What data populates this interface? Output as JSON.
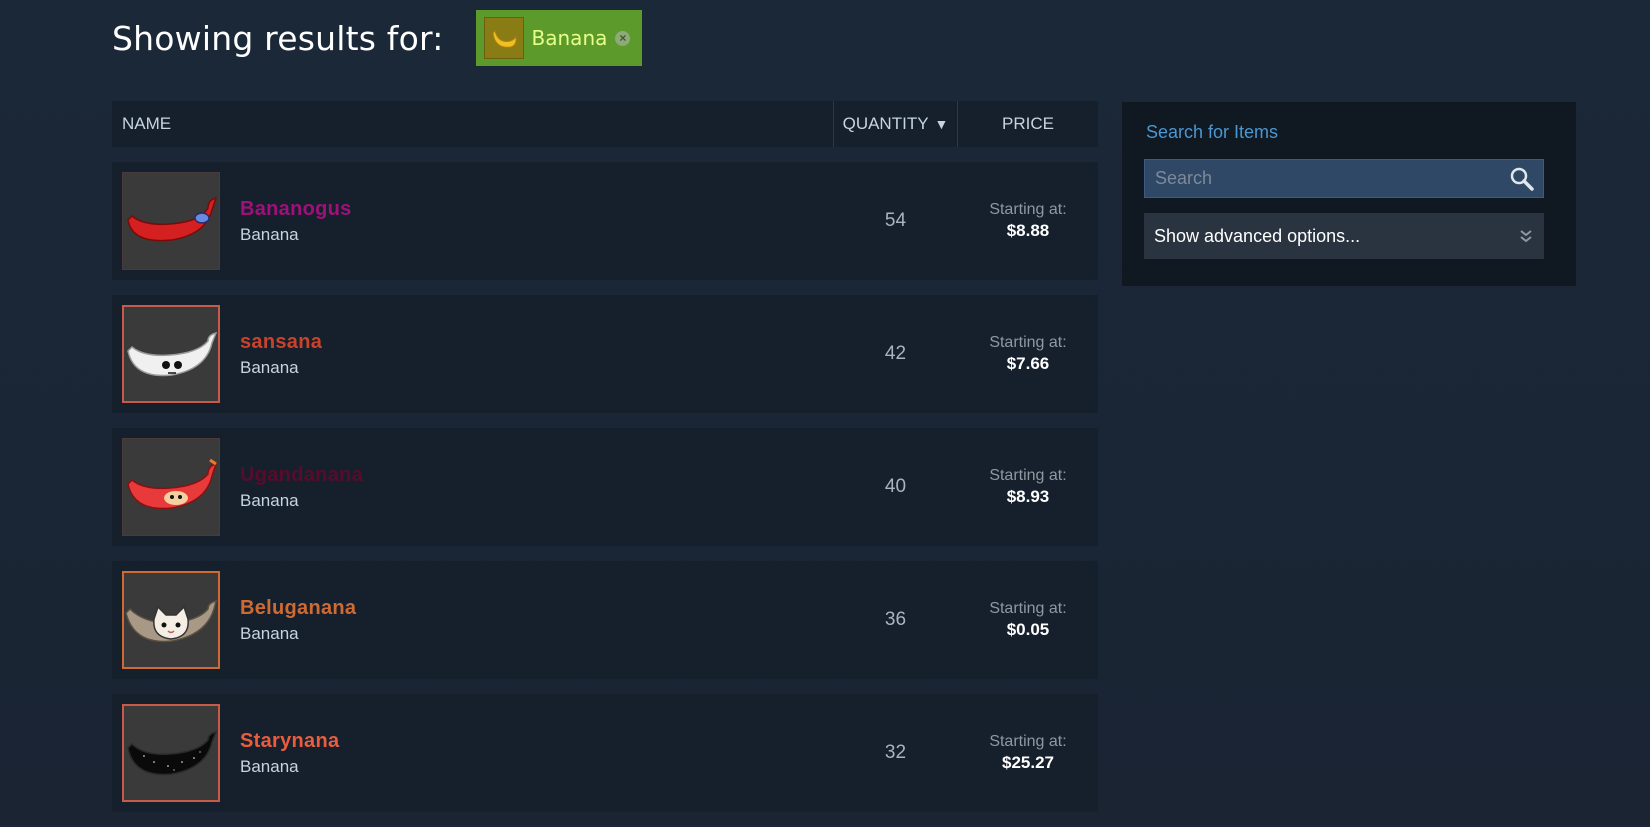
{
  "header": {
    "showing_text": "Showing results for:",
    "filter_label": "Banana",
    "filter_close": "×"
  },
  "table": {
    "col_name": "NAME",
    "col_quantity": "QUANTITY",
    "sort_indicator": "▼",
    "col_price": "PRICE"
  },
  "items": [
    {
      "name": "Bananogus",
      "type": "Banana",
      "quantity": "54",
      "price_label": "Starting at:",
      "price": "$8.88",
      "name_color": "#a0107a",
      "banana_color": "#d42020",
      "banana_icon": "red-banana-with-visor"
    },
    {
      "name": "sansana",
      "type": "Banana",
      "quantity": "42",
      "price_label": "Starting at:",
      "price": "$7.66",
      "name_color": "#c8432a",
      "banana_color": "#f0f0f0",
      "banana_icon": "white-banana-skull"
    },
    {
      "name": "Ugandanana",
      "type": "Banana",
      "quantity": "40",
      "price_label": "Starting at:",
      "price": "$8.93",
      "name_color": "#5a0a2a",
      "banana_color": "#e83a3a",
      "banana_icon": "red-banana-face"
    },
    {
      "name": "Beluganana",
      "type": "Banana",
      "quantity": "36",
      "price_label": "Starting at:",
      "price": "$0.05",
      "name_color": "#cf6a32",
      "banana_color": "#a89886",
      "banana_icon": "gray-banana-cat"
    },
    {
      "name": "Starynana",
      "type": "Banana",
      "quantity": "32",
      "price_label": "Starting at:",
      "price": "$25.27",
      "name_color": "#eb5c3c",
      "banana_color": "#0a0a0a",
      "banana_icon": "starry-black-banana"
    }
  ],
  "sidebar": {
    "title": "Search for Items",
    "search_placeholder": "Search",
    "advanced_label": "Show advanced options..."
  },
  "colors": {
    "background": "#1b2838",
    "row_bg": "#16202d",
    "filter_bg": "#5c9a2c",
    "link_blue": "#4b97d1"
  }
}
